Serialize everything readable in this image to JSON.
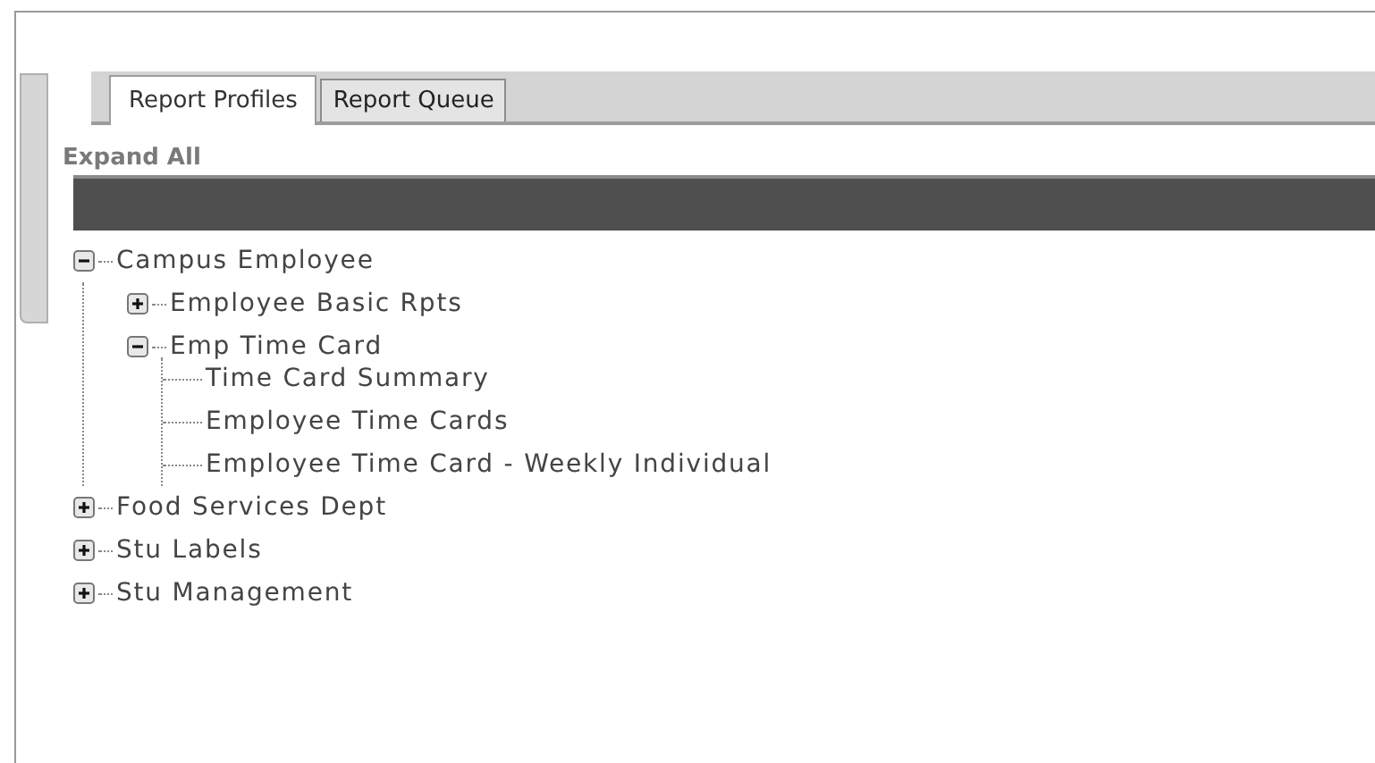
{
  "tabs": [
    {
      "label": "Report Profiles",
      "selected": true
    },
    {
      "label": "Report Queue",
      "selected": false
    }
  ],
  "expand_all": "Expand All",
  "tree": [
    {
      "label": "Campus Employee",
      "expanded": true,
      "children": [
        {
          "label": "Employee Basic Rpts",
          "expanded": false
        },
        {
          "label": "Emp Time Card",
          "expanded": true,
          "children": [
            {
              "label": "Time Card Summary"
            },
            {
              "label": "Employee Time Cards"
            },
            {
              "label": "Employee Time Card - Weekly Individual"
            }
          ]
        }
      ]
    },
    {
      "label": "Food Services Dept",
      "expanded": false
    },
    {
      "label": "Stu Labels",
      "expanded": false
    },
    {
      "label": "Stu Management",
      "expanded": false
    }
  ]
}
